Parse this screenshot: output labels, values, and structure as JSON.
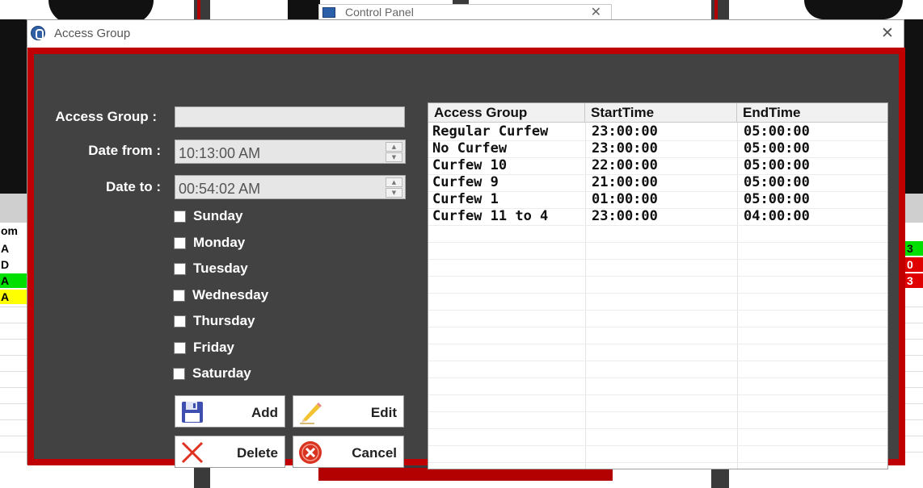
{
  "background": {
    "control_panel_title": "Control Panel",
    "left_grid": {
      "header": "om",
      "cells": [
        {
          "text": "A",
          "color": "#ffffff"
        },
        {
          "text": "D",
          "color": "#ffffff"
        },
        {
          "text": "A",
          "color": "#00e000"
        },
        {
          "text": "A",
          "color": "#ffff00"
        }
      ]
    },
    "right_grid": {
      "cells": [
        {
          "text": "3",
          "color": "#00e000"
        },
        {
          "text": "0",
          "color": "#e00000"
        },
        {
          "text": "3",
          "color": "#e00000"
        }
      ]
    }
  },
  "dialog": {
    "title": "Access Group",
    "close": "✕"
  },
  "form": {
    "access_group_label": "Access Group :",
    "access_group_value": "",
    "date_from_label": "Date from :",
    "date_from_value": "10:13:00 AM",
    "date_to_label": "Date to :",
    "date_to_value": "00:54:02 AM",
    "days": [
      "Sunday",
      "Monday",
      "Tuesday",
      "Wednesday",
      "Thursday",
      "Friday",
      "Saturday"
    ]
  },
  "buttons": {
    "add": "Add",
    "edit": "Edit",
    "delete": "Delete",
    "cancel": "Cancel"
  },
  "grid": {
    "columns": [
      "Access Group",
      "StartTime",
      "EndTime"
    ],
    "rows": [
      [
        "Regular Curfew",
        "23:00:00",
        "05:00:00"
      ],
      [
        "No Curfew",
        "23:00:00",
        "05:00:00"
      ],
      [
        "Curfew 10",
        "22:00:00",
        "05:00:00"
      ],
      [
        "Curfew 9",
        "21:00:00",
        "05:00:00"
      ],
      [
        "Curfew 1",
        "01:00:00",
        "05:00:00"
      ],
      [
        "Curfew 11 to 4",
        "23:00:00",
        "04:00:00"
      ]
    ]
  },
  "colors": {
    "frame_red": "#c00000",
    "panel_dark": "#424242"
  }
}
